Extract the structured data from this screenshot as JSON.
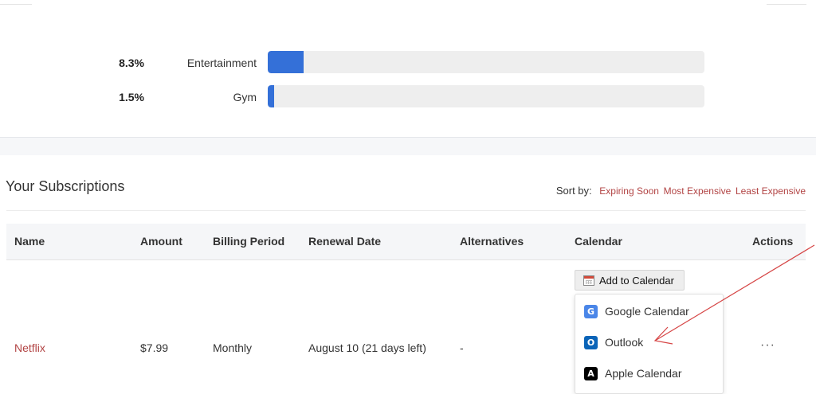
{
  "spending_breakdown": [
    {
      "percent_label": "8.3%",
      "category": "Entertainment",
      "share": 0.083
    },
    {
      "percent_label": "1.5%",
      "category": "Gym",
      "share": 0.015
    }
  ],
  "subscriptions": {
    "title": "Your Subscriptions",
    "sort": {
      "label": "Sort by:",
      "options": [
        "Expiring Soon",
        "Most Expensive",
        "Least Expensive"
      ]
    },
    "columns": [
      "Name",
      "Amount",
      "Billing Period",
      "Renewal Date",
      "Alternatives",
      "Calendar",
      "Actions"
    ],
    "rows": [
      {
        "name": "Netflix",
        "amount": "$7.99",
        "billing_period": "Monthly",
        "renewal_date": "August 10 (21 days left)",
        "alternatives": "-",
        "actions": "···"
      }
    ]
  },
  "calendar_menu": {
    "button_label": "Add to Calendar",
    "options": [
      {
        "label": "Google Calendar",
        "icon": "google-icon",
        "glyph": "G"
      },
      {
        "label": "Outlook",
        "icon": "outlook-icon",
        "glyph": "O"
      },
      {
        "label": "Apple Calendar",
        "icon": "apple-icon",
        "glyph": "A"
      }
    ]
  },
  "colors": {
    "bar_fill": "#3470d8",
    "bar_track": "#eeeeee",
    "link": "#b24444",
    "annotation_arrow": "#d64545"
  }
}
